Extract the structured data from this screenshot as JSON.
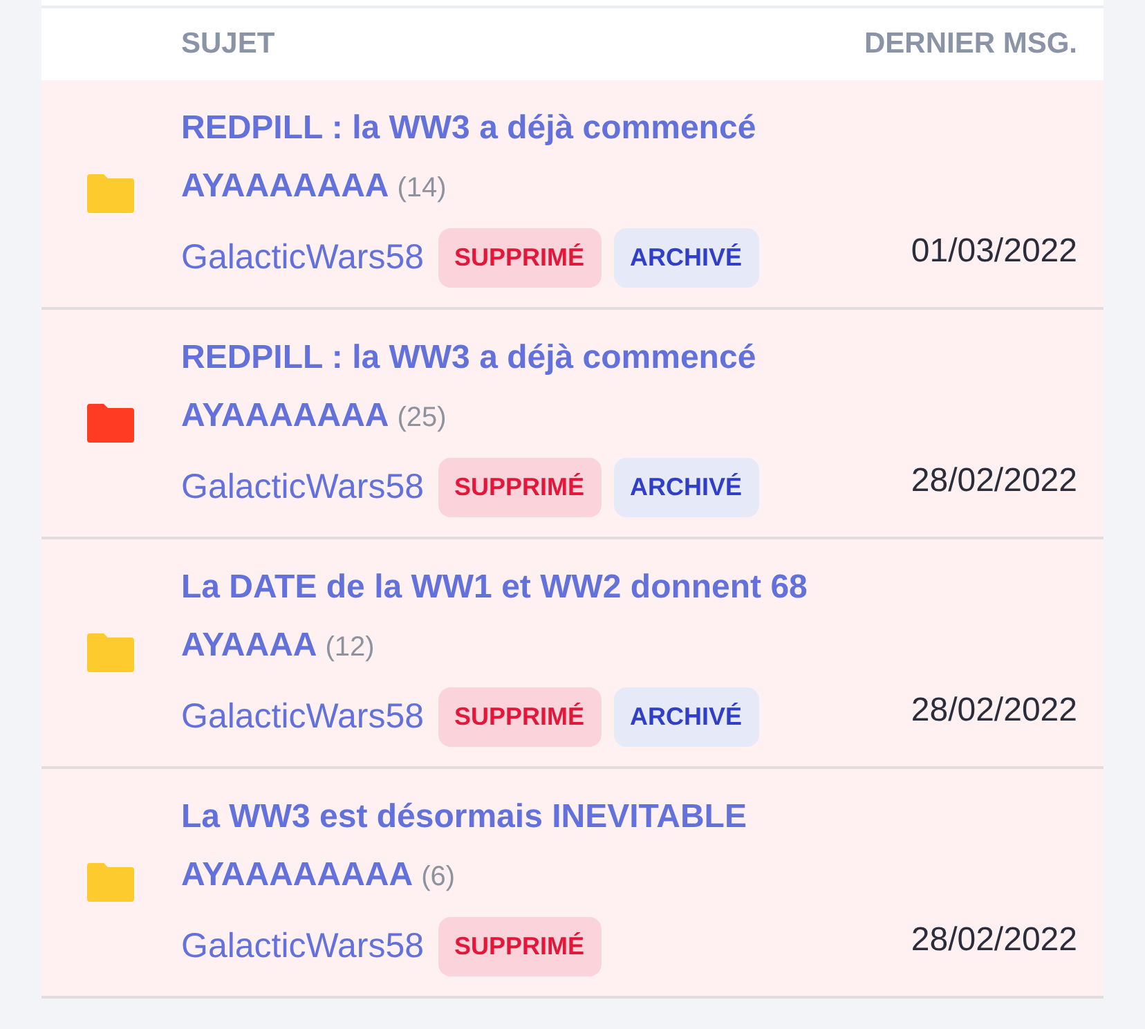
{
  "columns": [
    "SUJET",
    "DERNIER MSG."
  ],
  "topics": [
    {
      "title": "REDPILL : la WW3 a déjà commencé AYAAAAAAA",
      "count": "(14)",
      "author": "GalacticWars58",
      "color": "#fecb2f",
      "badges": [
        {
          "kind": "deleted",
          "label": "SUPPRIMÉ"
        },
        {
          "kind": "archived",
          "label": "ARCHIVÉ"
        }
      ],
      "date": "01/03/2022"
    },
    {
      "title": "REDPILL : la WW3 a déjà commencé AYAAAAAAA",
      "count": "(25)",
      "author": "GalacticWars58",
      "color": "#ff3b24",
      "badges": [
        {
          "kind": "deleted",
          "label": "SUPPRIMÉ"
        },
        {
          "kind": "archived",
          "label": "ARCHIVÉ"
        }
      ],
      "date": "28/02/2022"
    },
    {
      "title": "La DATE de la WW1 et WW2 donnent 68 AYAAAA",
      "count": "(12)",
      "author": "GalacticWars58",
      "color": "#fecb2f",
      "badges": [
        {
          "kind": "deleted",
          "label": "SUPPRIMÉ"
        },
        {
          "kind": "archived",
          "label": "ARCHIVÉ"
        }
      ],
      "date": "28/02/2022"
    },
    {
      "title": "La WW3 est désormais INEVITABLE AYAAAAAAAA",
      "count": "(6)",
      "author": "GalacticWars58",
      "color": "#fecb2f",
      "badges": [
        {
          "kind": "deleted",
          "label": "SUPPRIMÉ"
        }
      ],
      "date": "28/02/2022"
    }
  ]
}
